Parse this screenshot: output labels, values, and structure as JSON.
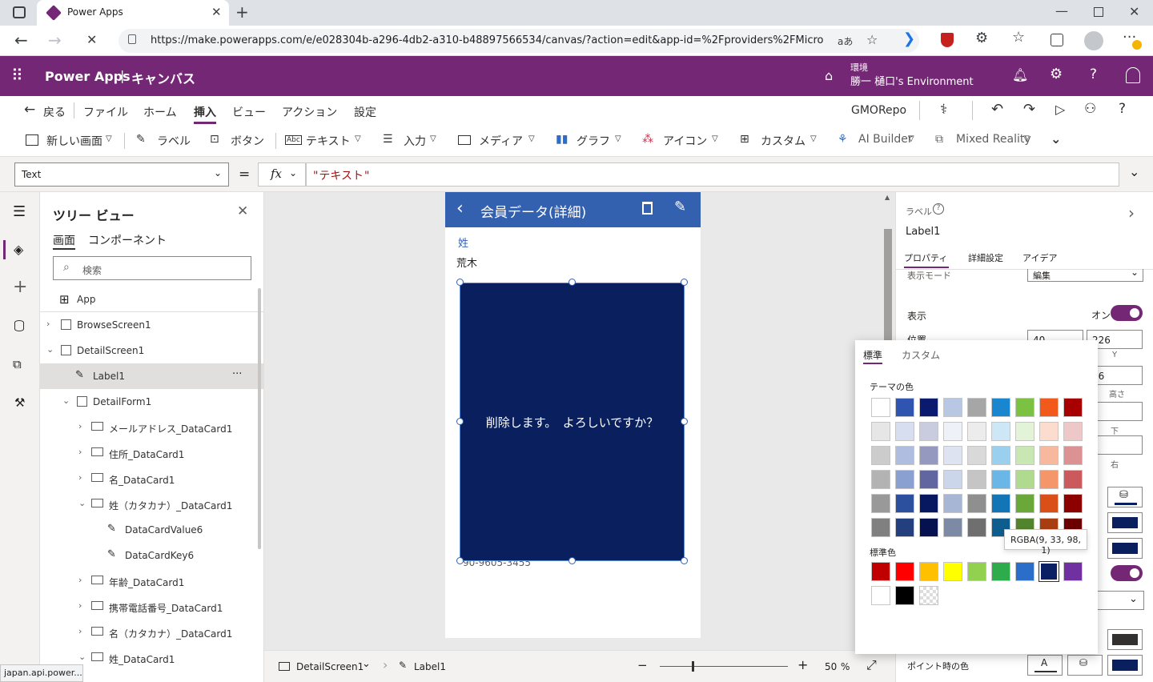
{
  "browser": {
    "tab_title": "Power Apps",
    "url": "https://make.powerapps.com/e/e028304b-a296-4db2-a310-b48897566534/canvas/?action=edit&app-id=%2Fproviders%2FMicrosoft....",
    "read_aloud": "aあ",
    "status_url": "japan.api.power..."
  },
  "appbar": {
    "title": "Power Apps",
    "separator": "|",
    "subtitle": "キャンバス",
    "env_label": "環境",
    "env_name": "勝一 樋口's Environment"
  },
  "menu": {
    "back": "戻る",
    "items": [
      "ファイル",
      "ホーム",
      "挿入",
      "ビュー",
      "アクション",
      "設定"
    ],
    "active": "挿入",
    "app_name": "GMORepo"
  },
  "ribbon": {
    "items": [
      "新しい画面",
      "ラベル",
      "ボタン",
      "テキスト",
      "入力",
      "メディア",
      "グラフ",
      "アイコン",
      "カスタム",
      "AI Builder",
      "Mixed Reality"
    ]
  },
  "formula": {
    "property": "Text",
    "equals": "=",
    "fx": "fx",
    "expression": "\"テキスト\""
  },
  "tree": {
    "title": "ツリー ビュー",
    "tabs": [
      "画面",
      "コンポーネント"
    ],
    "search_placeholder": "検索",
    "items": [
      {
        "label": "App"
      },
      {
        "label": "BrowseScreen1"
      },
      {
        "label": "DetailScreen1"
      },
      {
        "label": "Label1",
        "more": "···"
      },
      {
        "label": "DetailForm1"
      },
      {
        "label": "メールアドレス_DataCard1"
      },
      {
        "label": "住所_DataCard1"
      },
      {
        "label": "名_DataCard1"
      },
      {
        "label": "姓（カタカナ）_DataCard1"
      },
      {
        "label": "DataCardValue6"
      },
      {
        "label": "DataCardKey6"
      },
      {
        "label": "年齢_DataCard1"
      },
      {
        "label": "携帯電話番号_DataCard1"
      },
      {
        "label": "名（カタカナ）_DataCard1"
      },
      {
        "label": "姓_DataCard1"
      }
    ]
  },
  "phone": {
    "header_title": "会員データ(詳細)",
    "field_label": "姓",
    "field_value": "荒木",
    "label_text": "削除します。　よろしいですか？",
    "partial_phone": "90-9605-3455",
    "label_color": "#0a1f5e",
    "header_color": "#3460b0"
  },
  "bottom": {
    "screen": "DetailScreen1",
    "control": "Label1",
    "zoom": "50",
    "zoom_unit": "%"
  },
  "props": {
    "type": "ラベル",
    "name": "Label1",
    "tabs": [
      "プロパティ",
      "詳細設定",
      "アイデア"
    ],
    "display_mode_label": "表示モード",
    "display_mode_value": "編集",
    "visible_label": "表示",
    "visible_value": "オン",
    "position_label": "位置",
    "pos_x": "40",
    "pos_y": "226",
    "y_label": "Y",
    "height_value": "96",
    "height_label": "高さ",
    "bottom_label": "下",
    "right_label": "右",
    "hover_color_label": "ポイント時の色"
  },
  "picker": {
    "tabs": [
      "標準",
      "カスタム"
    ],
    "theme_label": "テーマの色",
    "standard_label": "標準色",
    "tooltip": "RGBA(9, 33, 98, 1)",
    "theme_rows": [
      [
        "#ffffff",
        "#3055b0",
        "#0a1a6e",
        "#b8c7e3",
        "#a6a6a6",
        "#1a86d0",
        "#7cc242",
        "#f25a1b",
        "#a80000"
      ],
      [
        "#e6e6e6",
        "#d7deef",
        "#c9cbdf",
        "#eef1f8",
        "#ececec",
        "#cde7f7",
        "#e3f3d8",
        "#fcdccf",
        "#eec8c9"
      ],
      [
        "#cccccc",
        "#afbde0",
        "#9599c0",
        "#dde3f1",
        "#d9d9d9",
        "#9bcfee",
        "#c9e7b3",
        "#f8b89d",
        "#dc9192"
      ],
      [
        "#b3b3b3",
        "#8aa0d1",
        "#6166a0",
        "#ccd6ea",
        "#c5c5c5",
        "#6ab6e6",
        "#b0db8e",
        "#f5956a",
        "#cb5a5c"
      ],
      [
        "#999999",
        "#2c4f9e",
        "#081860",
        "#a7b6d4",
        "#8f8f8f",
        "#1475b6",
        "#6aa83a",
        "#d94f17",
        "#8c0000"
      ],
      [
        "#808080",
        "#233f7e",
        "#061250",
        "#7c8aa6",
        "#6f6f6f",
        "#0f5c8f",
        "#52832d",
        "#a93d12",
        "#6b0000"
      ]
    ],
    "standard_colors": [
      "#c00000",
      "#ff0000",
      "#ffc000",
      "#ffff00",
      "#92d050",
      "#2eac4b",
      "#2a6ec9",
      "#0a2062",
      "#7030a0"
    ],
    "extra_colors": [
      "#ffffff",
      "#000000",
      "transparent"
    ]
  }
}
